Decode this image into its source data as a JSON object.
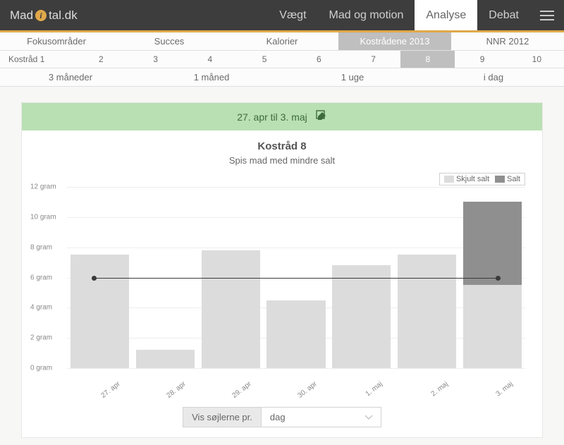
{
  "brand": {
    "prefix": "Mad",
    "suffix": "tal.dk"
  },
  "topnav": {
    "items": [
      "Vægt",
      "Mad og motion",
      "Analyse",
      "Debat"
    ],
    "active_index": 2
  },
  "subnav1": {
    "items": [
      "Fokusområder",
      "Succes",
      "Kalorier",
      "Kostrådene 2013",
      "NNR 2012"
    ],
    "active_index": 3
  },
  "subnav2": {
    "label": "Kostråd 1",
    "items": [
      "2",
      "3",
      "4",
      "5",
      "6",
      "7",
      "8",
      "9",
      "10"
    ],
    "active_index": 6
  },
  "subnav3": {
    "items": [
      "3 måneder",
      "1 måned",
      "1 uge",
      "i dag"
    ]
  },
  "datebar": {
    "text": "27. apr til 3. maj"
  },
  "chart": {
    "title": "Kostråd 8",
    "subtitle": "Spis mad med mindre salt"
  },
  "legend": {
    "skjult": "Skjult salt",
    "salt": "Salt"
  },
  "yticks": [
    "0 gram",
    "2 gram",
    "4 gram",
    "6 gram",
    "8 gram",
    "10 gram",
    "12 gram"
  ],
  "controls": {
    "label": "Vis søjlerne pr.",
    "selected": "dag"
  },
  "chart_data": {
    "type": "bar",
    "categories": [
      "27. apr",
      "28. apr",
      "29. apr",
      "30. apr",
      "1. maj",
      "2. maj",
      "3. maj"
    ],
    "series": [
      {
        "name": "Skjult salt",
        "values": [
          7.5,
          1.2,
          7.8,
          4.5,
          6.8,
          7.5,
          5.5
        ]
      },
      {
        "name": "Salt",
        "values": [
          0,
          0,
          0,
          0,
          0,
          0,
          5.5
        ]
      }
    ],
    "reference_line": 6,
    "ylim": [
      0,
      12
    ],
    "ylabel": "gram",
    "title": "Kostråd 8",
    "subtitle": "Spis mad med mindre salt"
  }
}
